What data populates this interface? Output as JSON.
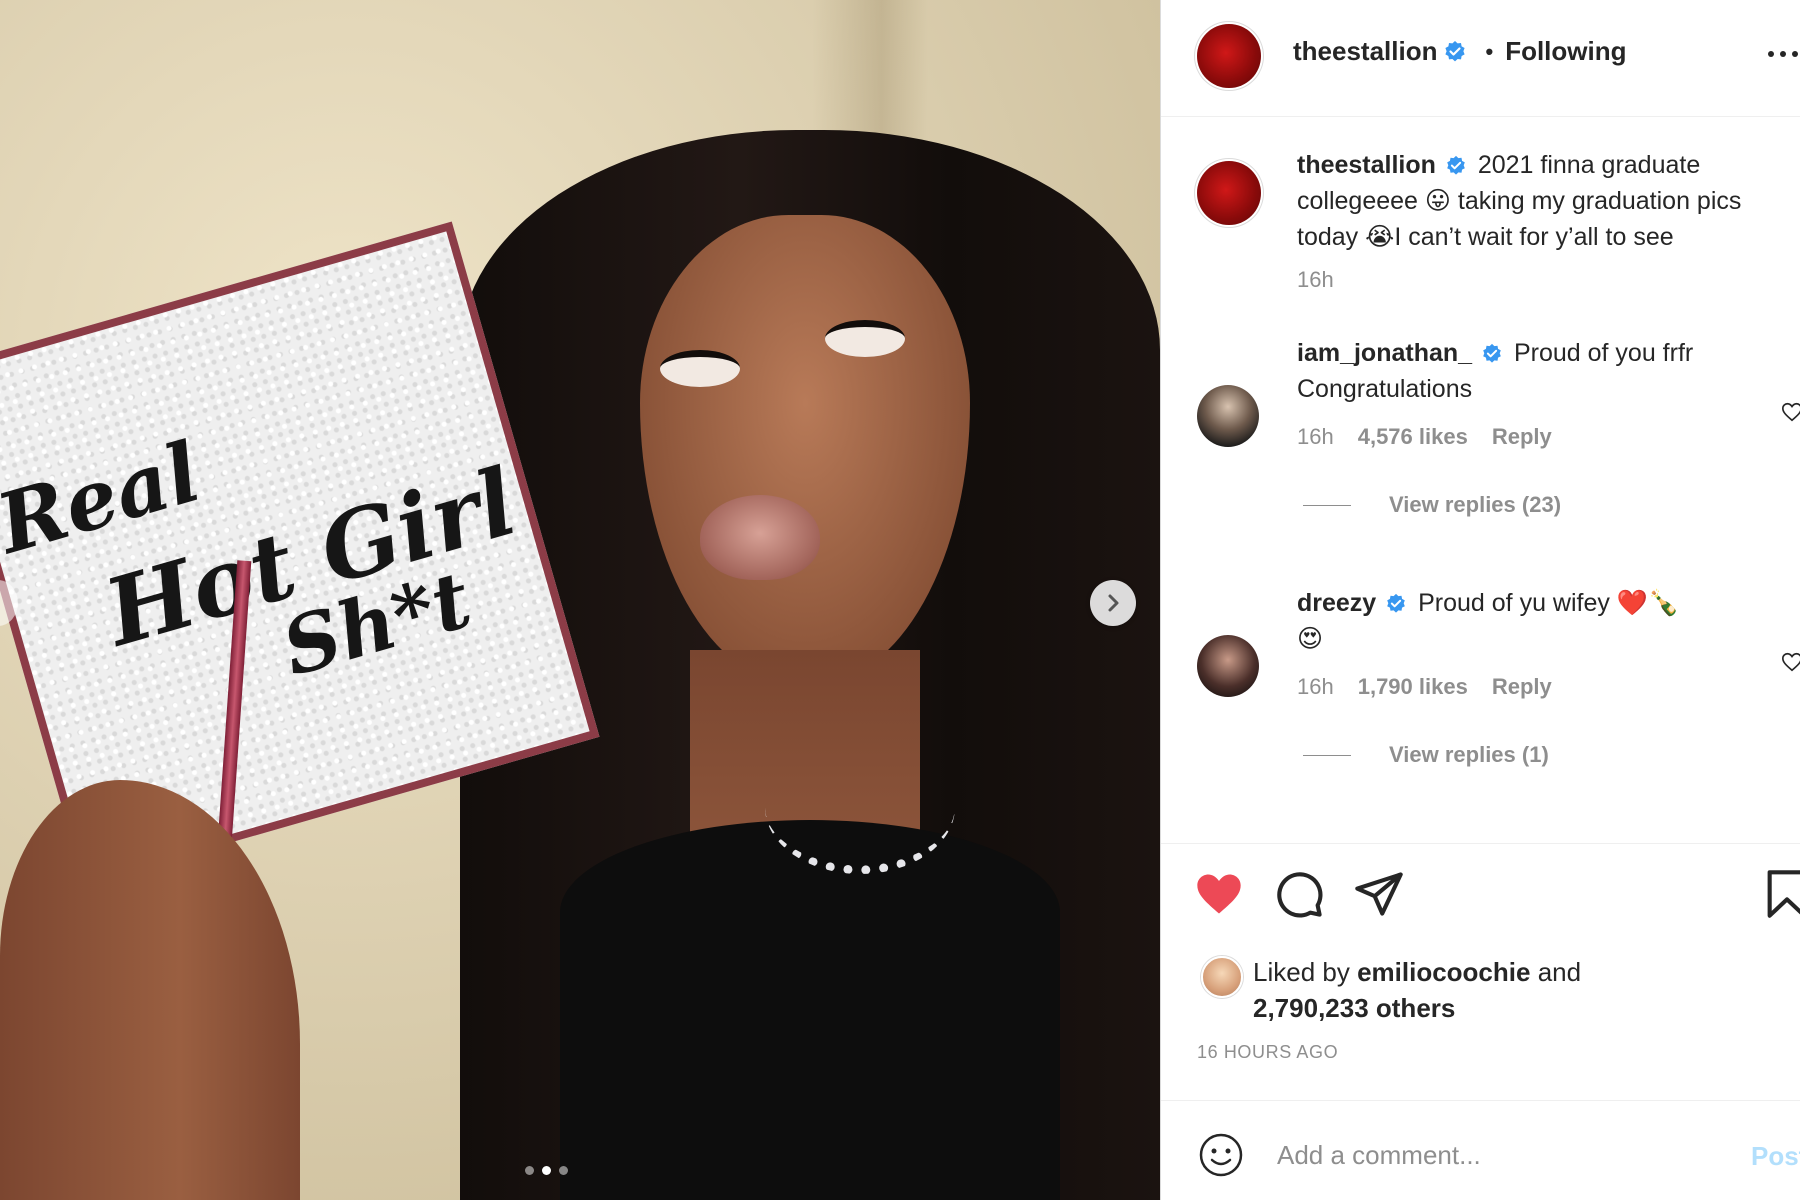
{
  "media": {
    "cap_text": [
      "Real",
      "Hot Girl",
      "Sh*t"
    ],
    "carousel": {
      "count": 3,
      "active": 2
    }
  },
  "header": {
    "username": "theestallion",
    "separator": "•",
    "follow_status": "Following"
  },
  "caption": {
    "username": "theestallion",
    "text_line1": "2021 finna graduate",
    "text_line2a": "collegeeee",
    "emoji1": "😛",
    "text_line2b": "taking my graduation pics",
    "text_line3a": "today",
    "emoji2": "😭",
    "text_line3b": "I can’t wait for y’all to see",
    "time": "16h"
  },
  "comments": [
    {
      "username": "iam_jonathan_",
      "line1": "Proud of you frfr",
      "line2": "Congratulations",
      "time": "16h",
      "likes": "4,576 likes",
      "reply": "Reply",
      "view_replies": "View replies (23)"
    },
    {
      "username": "dreezy",
      "line1": "Proud of yu wifey",
      "emoji_line1": "❤️🍾",
      "line2": "😍",
      "time": "16h",
      "likes": "1,790 likes",
      "reply": "Reply",
      "view_replies": "View replies (1)"
    }
  ],
  "likes": {
    "prefix": "Liked by",
    "user": "emiliocoochie",
    "and": "and",
    "others": "2,790,233 others"
  },
  "posted_ago": "16 HOURS AGO",
  "add_comment": {
    "placeholder": "Add a comment...",
    "post_label": "Post"
  },
  "colors": {
    "heart_liked": "#ed4956",
    "verified": "#3897f0",
    "post_disabled": "#b2dffc",
    "secondary_text": "#8e8e8e"
  },
  "icons": [
    "more-options-icon",
    "verified-badge-icon",
    "heart-icon",
    "comment-icon",
    "share-icon",
    "bookmark-icon",
    "emoji-icon",
    "chevron-right-icon"
  ]
}
